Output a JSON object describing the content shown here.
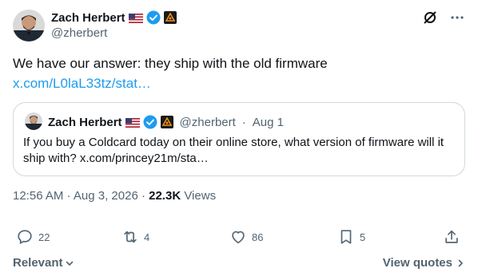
{
  "author": {
    "name": "Zach Herbert",
    "handle": "@zherbert"
  },
  "tweet": {
    "text": "We have our answer: they ship with the old firmware",
    "link": "x.com/L0laL33tz/stat…"
  },
  "quote": {
    "name": "Zach Herbert",
    "handle": "@zherbert",
    "separator": "·",
    "date": "Aug 1",
    "text": "If you buy a Coldcard today on their online store, what version of firmware will it ship with? x.com/princey21m/sta…"
  },
  "meta": {
    "time_date": "12:56 AM · Aug 3, 2026 · ",
    "views_count": "22.3K",
    "views_label": " Views"
  },
  "actions": {
    "replies": "22",
    "reposts": "4",
    "likes": "86",
    "bookmarks": "5"
  },
  "footer": {
    "relevant": "Relevant",
    "view_quotes": "View quotes"
  },
  "colors": {
    "accent": "#1d9bf0",
    "muted": "#536471",
    "text": "#0f1419"
  }
}
